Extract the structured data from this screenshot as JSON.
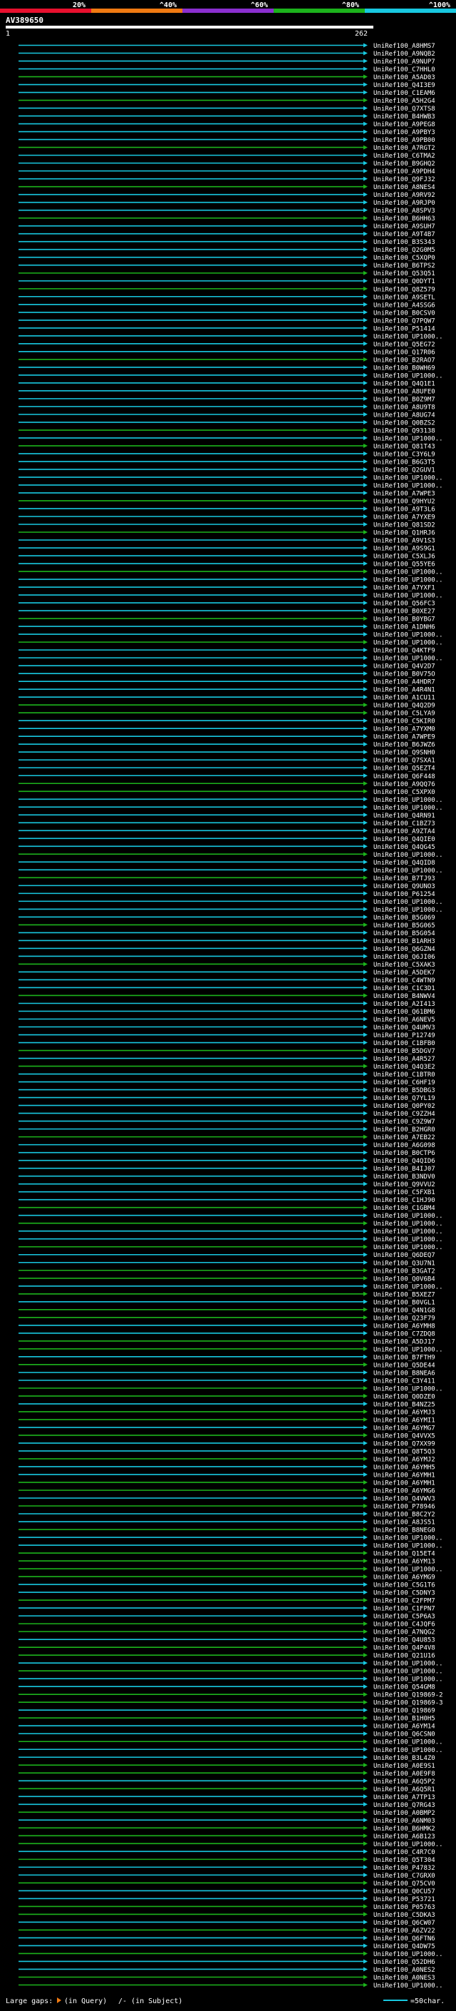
{
  "chart_data": {
    "type": "alignment-overview",
    "query_id": "AV389650",
    "scale_start": "1",
    "scale_end": "262",
    "identity_scale": {
      "colors": [
        "#e8102e",
        "#f07a12",
        "#8b2fd0",
        "#1cb31c",
        "#18c8e0"
      ],
      "labels": [
        "20%",
        "^40%",
        "^60%",
        "^80%",
        "^100%"
      ]
    },
    "hit_labels": [
      "UniRef100_A8HMS7",
      "UniRef100_A9NQB2",
      "UniRef100_A9NUP7",
      "UniRef100_C7HHL0",
      "UniRef100_A5AD03",
      "UniRef100_Q4I3E9",
      "UniRef100_C1EAM6",
      "UniRef100_A5H2G4",
      "UniRef100_Q7XTS8",
      "UniRef100_B4HWB3",
      "UniRef100_A9PEG8",
      "UniRef100_A9PBY3",
      "UniRef100_A9PB00",
      "UniRef100_A7RGT2",
      "UniRef100_C6TMA2",
      "UniRef100_B9GHQ2",
      "UniRef100_A9PDH4",
      "UniRef100_Q9FJ32",
      "UniRef100_A8NES4",
      "UniRef100_A9RV92",
      "UniRef100_A9RJP0",
      "UniRef100_A8SPV3",
      "UniRef100_B6HH63",
      "UniRef100_A9SUH7",
      "UniRef100_A9T4B7",
      "UniRef100_B3S343",
      "UniRef100_Q2G0M5",
      "UniRef100_C5XQP0",
      "UniRef100_B6TPS2",
      "UniRef100_Q53Q51",
      "UniRef100_Q0DYT1",
      "UniRef100_Q8Z579",
      "UniRef100_A9SETL",
      "UniRef100_A4SSG6",
      "UniRef100_B0CSV0",
      "UniRef100_Q7PQW7",
      "UniRef100_P51414",
      "UniRef100_UP1000..",
      "UniRef100_Q5EG72",
      "UniRef100_Q17R06",
      "UniRef100_B2RAO7",
      "UniRef100_B0WH69",
      "UniRef100_UP1000..",
      "UniRef100_Q4Q1E1",
      "UniRef100_A8UFE0",
      "UniRef100_B0Z9M7",
      "UniRef100_A8U9T8",
      "UniRef100_A8UG74",
      "UniRef100_Q0BZS2",
      "UniRef100_Q93138",
      "UniRef100_UP1000..",
      "UniRef100_Q81T43",
      "UniRef100_C3Y6L9",
      "UniRef100_B6G3T5",
      "UniRef100_Q2GUV1",
      "UniRef100_UP1000..",
      "UniRef100_UP1000..",
      "UniRef100_A7WPE3",
      "UniRef100_Q9HYU2",
      "UniRef100_A9T3L6",
      "UniRef100_A7YXE9",
      "UniRef100_Q81SD2",
      "UniRef100_Q1HRJ6",
      "UniRef100_A9V1S3",
      "UniRef100_A9S9G1",
      "UniRef100_C5XLJ6",
      "UniRef100_Q55YE6",
      "UniRef100_UP1000..",
      "UniRef100_UP1000..",
      "UniRef100_A7YXF1",
      "UniRef100_UP1000..",
      "UniRef100_Q56FC3",
      "UniRef100_B0XE27",
      "UniRef100_B0YBG7",
      "UniRef100_A1DNH6",
      "UniRef100_UP1000..",
      "UniRef100_UP1000..",
      "UniRef100_Q4KTF9",
      "UniRef100_UP1000..",
      "UniRef100_Q4V2D7",
      "UniRef100_B0V75O",
      "UniRef100_A4HDR7",
      "UniRef100_A4R4N1",
      "UniRef100_A1CU11",
      "UniRef100_Q4Q2D9",
      "UniRef100_C5LYA9",
      "UniRef100_C5KIR0",
      "UniRef100_A7YXM0",
      "UniRef100_A7WPE9",
      "UniRef100_B6JWZ6",
      "UniRef100_Q9SNH0",
      "UniRef100_Q7SXA1",
      "UniRef100_Q5EZT4",
      "UniRef100_Q6F448",
      "UniRef100_A9QQ76",
      "UniRef100_C5XPX0",
      "UniRef100_UP1000..",
      "UniRef100_UP1000..",
      "UniRef100_Q4RN91",
      "UniRef100_C1BZ73",
      "UniRef100_A9ZTA4",
      "UniRef100_Q4QIE0",
      "UniRef100_Q4QG45",
      "UniRef100_UP1000..",
      "UniRef100_Q4QID8",
      "UniRef100_UP1000..",
      "UniRef100_B7TJ93",
      "UniRef100_Q9UNO3",
      "UniRef100_P61254",
      "UniRef100_UP1000..",
      "UniRef100_UP1000..",
      "UniRef100_B5G069",
      "UniRef100_B5G065",
      "UniRef100_B5G054",
      "UniRef100_B1ARH3",
      "UniRef100_Q6GZN4",
      "UniRef100_Q6JI06",
      "UniRef100_C5XAK3",
      "UniRef100_A5DEK7",
      "UniRef100_C4WTN9",
      "UniRef100_C1C3D1",
      "UniRef100_B4NWV4",
      "UniRef100_A2I413",
      "UniRef100_Q61BM6",
      "UniRef100_A6NEV5",
      "UniRef100_Q4UMV3",
      "UniRef100_P12749",
      "UniRef100_C1BFB0",
      "UniRef100_B5DGV7",
      "UniRef100_A4R527",
      "UniRef100_Q4Q3E2",
      "UniRef100_C1BTR0",
      "UniRef100_C6HF19",
      "UniRef100_B5DBG3",
      "UniRef100_Q7YL19",
      "UniRef100_Q0PY02",
      "UniRef100_C9ZZH4",
      "UniRef100_C9Z9W7",
      "UniRef100_B2HGR0",
      "UniRef100_A7EB22",
      "UniRef100_A6G098",
      "UniRef100_B0CTP6",
      "UniRef100_Q4QID6",
      "UniRef100_B4IJ07",
      "UniRef100_B3NDV0",
      "UniRef100_Q9VVU2",
      "UniRef100_C5FXB1",
      "UniRef100_C1HJ90",
      "UniRef100_C1GBM4",
      "UniRef100_UP1000..",
      "UniRef100_UP1000..",
      "UniRef100_UP1000..",
      "UniRef100_UP1000..",
      "UniRef100_UP1000..",
      "UniRef100_Q6DEQ7",
      "UniRef100_Q3U7N1",
      "UniRef100_B3GAT2",
      "UniRef100_Q0V6B4",
      "UniRef100_UP1000..",
      "UniRef100_B5XEZ7",
      "UniRef100_B0VGL1",
      "UniRef100_Q4N1G8",
      "UniRef100_Q23F79",
      "UniRef100_A6YMH8",
      "UniRef100_C7ZDQ8",
      "UniRef100_A5DJ17",
      "UniRef100_UP1000..",
      "UniRef100_B7FTH9",
      "UniRef100_Q5DE44",
      "UniRef100_B8NEA6",
      "UniRef100_C3Y411",
      "UniRef100_UP1000..",
      "UniRef100_Q0DZE0",
      "UniRef100_B4NZ25",
      "UniRef100_A6YMJ3",
      "UniRef100_A6YMI1",
      "UniRef100_A6YMG7",
      "UniRef100_Q4VVX5",
      "UniRef100_Q7XX99",
      "UniRef100_Q8T5Q3",
      "UniRef100_A6YMJ2",
      "UniRef100_A6YMH5",
      "UniRef100_A6YMH1",
      "UniRef100_A6YMH1",
      "UniRef100_A6YMG6",
      "UniRef100_Q4VWV3",
      "UniRef100_P78946",
      "UniRef100_B8C2Y2",
      "UniRef100_A8JS51",
      "UniRef100_B8NEG0",
      "UniRef100_UP1000..",
      "UniRef100_UP1000..",
      "UniRef100_Q15ET4",
      "UniRef100_A6YM13",
      "UniRef100_UP1000..",
      "UniRef100_A6YMG9",
      "UniRef100_C5G1T6",
      "UniRef100_C5DNY3",
      "UniRef100_C2FPM7",
      "UniRef100_C1FPN7",
      "UniRef100_C5P6A3",
      "UniRef100_C4JQF6",
      "UniRef100_A7NQG2",
      "UniRef100_Q4U853",
      "UniRef100_Q4P4V8",
      "UniRef100_Q21U16",
      "UniRef100_UP1000..",
      "UniRef100_UP1000..",
      "UniRef100_UP1000..",
      "UniRef100_Q54GM8",
      "UniRef100_Q19869-2",
      "UniRef100_Q19869-3",
      "UniRef100_Q19869",
      "UniRef100_B1H0H5",
      "UniRef100_A6YM14",
      "UniRef100_Q6CSN0",
      "UniRef100_UP1000..",
      "UniRef100_UP1000..",
      "UniRef100_B3L4Z0",
      "UniRef100_A0E9S1",
      "UniRef100_A0E9F8",
      "UniRef100_A6Q5P2",
      "UniRef100_A6Q5R1",
      "UniRef100_A7TP13",
      "UniRef100_Q7RG43",
      "UniRef100_A0BMP2",
      "UniRef100_A6NM03",
      "UniRef100_B6HMK2",
      "UniRef100_A6B123",
      "UniRef100_UP1000..",
      "UniRef100_C4R7C0",
      "UniRef100_Q5T304",
      "UniRef100_P47832",
      "UniRef100_C7GRX0",
      "UniRef100_Q75CV0",
      "UniRef100_Q0CU57",
      "UniRef100_P53721",
      "UniRef100_P05763",
      "UniRef100_C5DKA3",
      "UniRef100_Q6CW07",
      "UniRef100_A6ZV22",
      "UniRef100_Q6FTN6",
      "UniRef100_Q4DW75",
      "UniRef100_UP1000..",
      "UniRef100_Q52DH6",
      "UniRef100_A0NES2",
      "UniRef100_A0NES3",
      "UniRef100_UP1000.."
    ],
    "footer": {
      "large_gaps_label": "Large gaps:",
      "in_query_label": "(in Query)",
      "in_subject_label": "(in Subject)",
      "scale_label": "=50char."
    }
  }
}
